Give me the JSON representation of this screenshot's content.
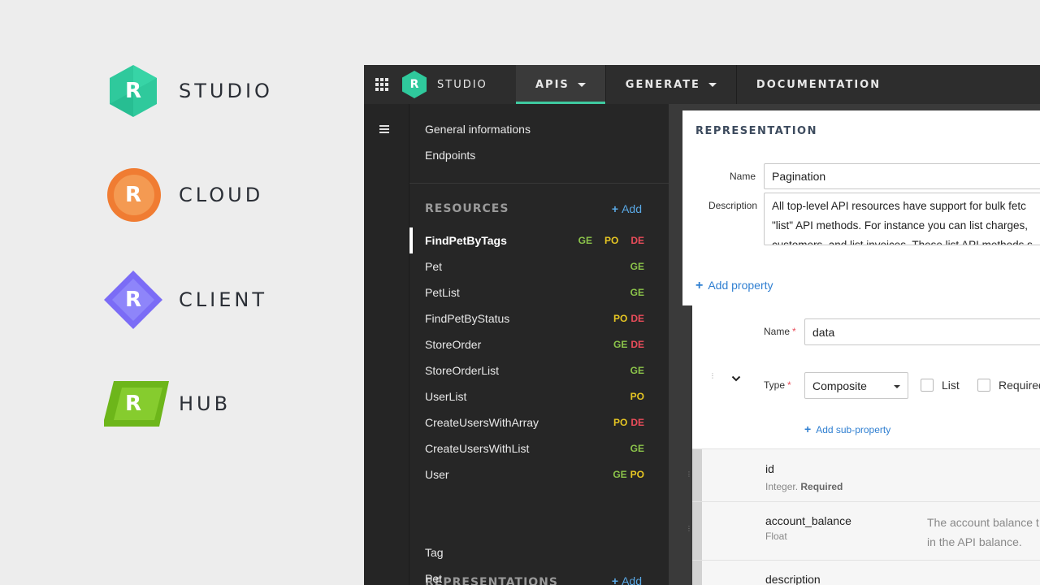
{
  "brands": [
    {
      "word": "STUDIO",
      "letter": "R",
      "color": "#2fc99c",
      "icon": "studio-hexagon-icon"
    },
    {
      "word": "CLOUD",
      "letter": "R",
      "color": "#f07c32",
      "icon": "cloud-circle-icon"
    },
    {
      "word": "CLIENT",
      "letter": "R",
      "color": "#7b6cf6",
      "icon": "client-diamond-icon"
    },
    {
      "word": "HUB",
      "letter": "R",
      "color": "#7ac21e",
      "icon": "hub-parallelogram-icon"
    }
  ],
  "topbar": {
    "logo_letter": "R",
    "logo_text": "STUDIO",
    "tabs": [
      {
        "label": "APIS",
        "active": true
      },
      {
        "label": "GENERATE",
        "active": false
      },
      {
        "label": "DOCUMENTATION",
        "active": false
      }
    ],
    "accent": "#3fcaa0"
  },
  "sidebar": {
    "links": [
      "General informations",
      "Endpoints"
    ],
    "resources_heading": "RESOURCES",
    "representations_heading": "REPRESENTATIONS",
    "add_label": "Add",
    "resources": [
      {
        "name": "FindPetByTags",
        "methods": [
          "GE",
          "PO",
          "DE"
        ],
        "active": true
      },
      {
        "name": "Pet",
        "methods": [
          "GE"
        ]
      },
      {
        "name": "PetList",
        "methods": [
          "GE"
        ]
      },
      {
        "name": "FindPetByStatus",
        "methods": [
          "PO",
          "DE"
        ]
      },
      {
        "name": "StoreOrder",
        "methods": [
          "GE",
          "DE"
        ]
      },
      {
        "name": "StoreOrderList",
        "methods": [
          "GE"
        ]
      },
      {
        "name": "UserList",
        "methods": [
          "PO"
        ]
      },
      {
        "name": "CreateUsersWithArray",
        "methods": [
          "PO",
          "DE"
        ]
      },
      {
        "name": "CreateUsersWithList",
        "methods": [
          "GE"
        ]
      },
      {
        "name": "User",
        "methods": [
          "GE",
          "PO"
        ]
      }
    ],
    "representations": [
      "Tag",
      "Pet"
    ]
  },
  "representation": {
    "title": "REPRESENTATION",
    "name_label": "Name",
    "name_value": "Pagination",
    "description_label": "Description",
    "description_lines": [
      "All top-level API resources have support for bulk fetc",
      "\"list\" API methods. For instance you can list charges,",
      "customers, and list invoices. These list API methods s"
    ],
    "add_property_label": "Add property"
  },
  "property": {
    "name_label": "Name",
    "name_value": "data",
    "type_label": "Type",
    "type_value": "Composite",
    "required_mark": "*",
    "list_label": "List",
    "required_label": "Required",
    "add_sub_property_label": "Add sub-property"
  },
  "sub_properties": [
    {
      "name": "id",
      "type": "Integer.",
      "flag": "Required",
      "desc_lines": []
    },
    {
      "name": "account_balance",
      "type": "Float",
      "flag": "",
      "desc_lines": [
        "The account balance t",
        "in the API balance."
      ]
    },
    {
      "name": "description",
      "type": "",
      "flag": "",
      "desc_lines": []
    }
  ]
}
